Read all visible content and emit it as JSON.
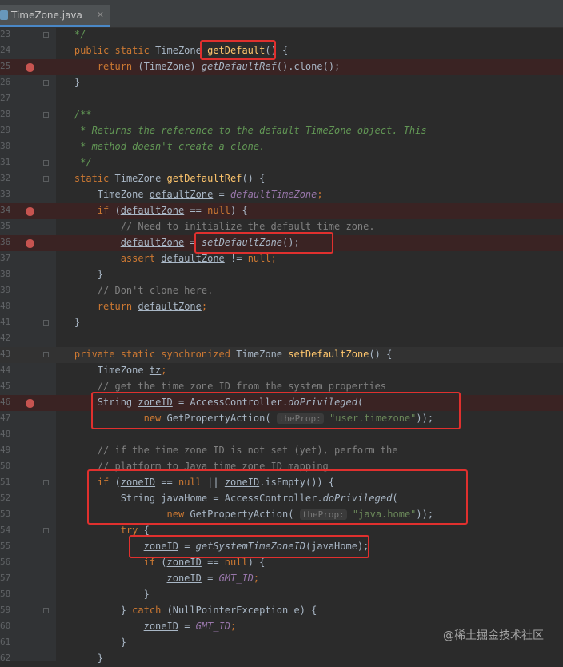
{
  "tab": {
    "label": "TimeZone.java",
    "close": "✕"
  },
  "code": {
    "l23": "*/",
    "l24_mod": "public static",
    "l24_type": "TimeZone",
    "l24_fn": "getDefault",
    "l24_rest": "() {",
    "l25_kw": "return",
    "l25_cast": "(TimeZone)",
    "l25_call": "getDefaultRef",
    "l25_rest": "().clone();",
    "l26": "}",
    "l28": "/**",
    "l29": "* Returns the reference to the default TimeZone object. This",
    "l30": "* method doesn't create a clone.",
    "l31": "*/",
    "l32_kw": "static",
    "l32_type": "TimeZone",
    "l32_fn": "getDefaultRef",
    "l32_rest": "() {",
    "l33_type": "TimeZone",
    "l33_var": "defaultZone",
    "l33_eq": "=",
    "l33_cst": "defaultTimeZone",
    "l33_semi": ";",
    "l34_kw": "if",
    "l34_open": "(",
    "l34_var": "defaultZone",
    "l34_op": "==",
    "l34_null": "null",
    "l34_rest": ") {",
    "l35": "// Need to initialize the default time zone.",
    "l36_var": "defaultZone",
    "l36_eq": "=",
    "l36_call": "setDefaultZone",
    "l36_rest": "();",
    "l37_kw": "assert",
    "l37_var": "defaultZone",
    "l37_op": "!=",
    "l37_null": "null",
    "l37_semi": ";",
    "l38": "}",
    "l39": "// Don't clone here.",
    "l40_kw": "return",
    "l40_var": "defaultZone",
    "l40_semi": ";",
    "l41": "}",
    "l43_mod": "private static synchronized",
    "l43_type": "TimeZone",
    "l43_fn": "setDefaultZone",
    "l43_rest": "() {",
    "l44_type": "TimeZone",
    "l44_var": "tz",
    "l44_semi": ";",
    "l45": "// get the time zone ID from the system properties",
    "l46_type": "String",
    "l46_var": "zoneID",
    "l46_eq": "= AccessController.",
    "l46_call": "doPrivileged",
    "l46_rest": "(",
    "l47_kw": "new",
    "l47_cls": "GetPropertyAction(",
    "l47_hint": "theProp:",
    "l47_str": "\"user.timezone\"",
    "l47_rest": "));",
    "l49": "// if the time zone ID is not set (yet), perform the",
    "l50": "// platform to Java time zone ID mapping",
    "l51_kw": "if",
    "l51_open": "(",
    "l51_var": "zoneID",
    "l51_op": "==",
    "l51_null": "null",
    "l51_or": "||",
    "l51_var2": "zoneID",
    "l51_rest": ".isEmpty()) {",
    "l52_type": "String",
    "l52_var": "javaHome",
    "l52_eq": "= AccessController.",
    "l52_call": "doPrivileged",
    "l52_rest": "(",
    "l53_kw": "new",
    "l53_cls": "GetPropertyAction(",
    "l53_hint": "theProp:",
    "l53_str": "\"java.home\"",
    "l53_rest": "));",
    "l54_kw": "try",
    "l54_rest": "{",
    "l55_var": "zoneID",
    "l55_eq": "=",
    "l55_call": "getSystemTimeZoneID",
    "l55_rest": "(javaHome);",
    "l56_kw": "if",
    "l56_open": "(",
    "l56_var": "zoneID",
    "l56_op": "==",
    "l56_null": "null",
    "l56_rest": ") {",
    "l57_var": "zoneID",
    "l57_eq": "=",
    "l57_cst": "GMT_ID",
    "l57_semi": ";",
    "l58": "}",
    "l59_close": "}",
    "l59_kw": "catch",
    "l59_rest": "(NullPointerException e) {",
    "l60_var": "zoneID",
    "l60_eq": "=",
    "l60_cst": "GMT_ID",
    "l60_semi": ";",
    "l61": "}",
    "l62": "}"
  },
  "line_numbers": [
    "23",
    "24",
    "25",
    "26",
    "27",
    "28",
    "29",
    "30",
    "31",
    "32",
    "33",
    "34",
    "35",
    "36",
    "37",
    "38",
    "39",
    "40",
    "41",
    "42",
    "43",
    "44",
    "45",
    "46",
    "47",
    "48",
    "49",
    "50",
    "51",
    "52",
    "53",
    "54",
    "55",
    "56",
    "57",
    "58",
    "59",
    "60",
    "61",
    "62"
  ],
  "watermark": "@稀土掘金技术社区",
  "colors": {
    "background": "#2b2b2b",
    "keyword": "#cc7832",
    "method_decl": "#ffc66d",
    "comment": "#808080",
    "doc_comment": "#629755",
    "string": "#6a8759",
    "constant": "#9876aa",
    "breakpoint": "#c75450",
    "highlight_box": "#e0302e"
  }
}
